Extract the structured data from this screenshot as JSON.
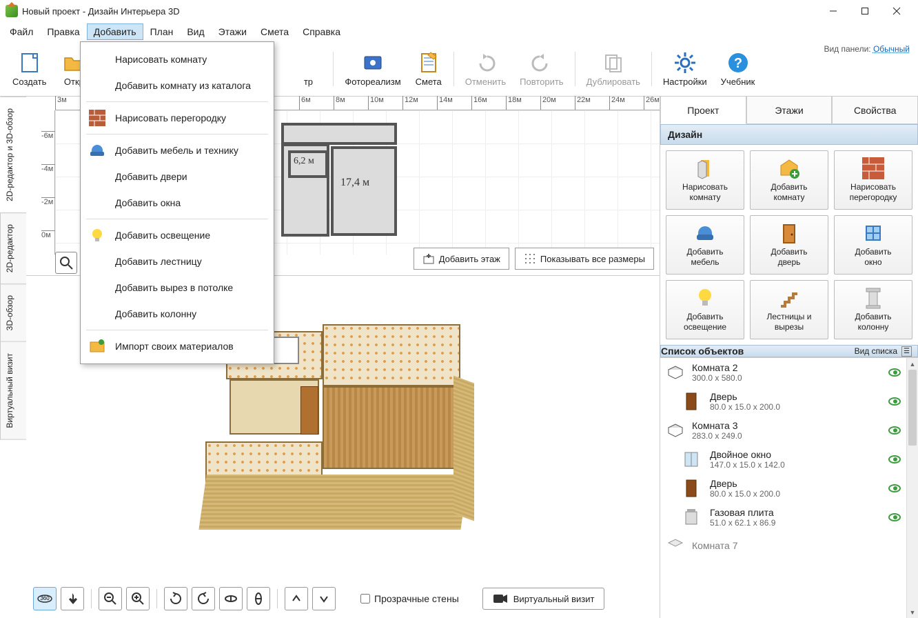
{
  "titlebar": {
    "title": "Новый проект - Дизайн Интерьера 3D"
  },
  "menubar": [
    "Файл",
    "Правка",
    "Добавить",
    "План",
    "Вид",
    "Этажи",
    "Смета",
    "Справка"
  ],
  "active_menu_index": 2,
  "toolbar": {
    "create": "Создать",
    "open": "Откр",
    "hidden1": "тр",
    "photoreal": "Фотореализм",
    "budget": "Смета",
    "undo": "Отменить",
    "redo": "Повторить",
    "duplicate": "Дублировать",
    "settings": "Настройки",
    "help": "Учебник",
    "panel_mode_label": "Вид панели:",
    "panel_mode_value": "Обычный"
  },
  "dropdown": [
    {
      "icon": "draw-room",
      "label": "Нарисовать комнату"
    },
    {
      "icon": "catalog",
      "label": "Добавить комнату из каталога"
    },
    {
      "sep": true
    },
    {
      "icon": "wall",
      "label": "Нарисовать перегородку"
    },
    {
      "sep": true
    },
    {
      "icon": "chair",
      "label": "Добавить мебель и технику"
    },
    {
      "icon": "",
      "label": "Добавить двери"
    },
    {
      "icon": "",
      "label": "Добавить окна"
    },
    {
      "sep": true
    },
    {
      "icon": "bulb",
      "label": "Добавить освещение"
    },
    {
      "icon": "",
      "label": "Добавить лестницу"
    },
    {
      "icon": "",
      "label": "Добавить вырез в потолке"
    },
    {
      "icon": "",
      "label": "Добавить колонну"
    },
    {
      "sep": true
    },
    {
      "icon": "import",
      "label": "Импорт своих материалов"
    }
  ],
  "vtabs": [
    "2D-редактор и 3D-обзор",
    "2D-редактор",
    "3D-обзор",
    "Виртуальный визит"
  ],
  "ruler_h": [
    "3м",
    "6м",
    "8м",
    "10м",
    "12м",
    "14м",
    "16м",
    "18м",
    "20м",
    "22м",
    "24м",
    "26м"
  ],
  "ruler_v": [
    "-6м",
    "-4м",
    "-2м",
    "0м"
  ],
  "plan_areas": {
    "small": "6,2 м",
    "big": "17,4 м"
  },
  "plan_btn_add": "Добавить этаж",
  "plan_btn_dims": "Показывать все размеры",
  "side_tabs": [
    "Проект",
    "Этажи",
    "Свойства"
  ],
  "section_design": "Дизайн",
  "design_buttons": [
    {
      "icon": "tools",
      "l1": "Нарисовать",
      "l2": "комнату"
    },
    {
      "icon": "addbox",
      "l1": "Добавить",
      "l2": "комнату"
    },
    {
      "icon": "brick",
      "l1": "Нарисовать",
      "l2": "перегородку"
    },
    {
      "icon": "sofa",
      "l1": "Добавить",
      "l2": "мебель"
    },
    {
      "icon": "door",
      "l1": "Добавить",
      "l2": "дверь"
    },
    {
      "icon": "window",
      "l1": "Добавить",
      "l2": "окно"
    },
    {
      "icon": "bulb",
      "l1": "Добавить",
      "l2": "освещение"
    },
    {
      "icon": "stairs",
      "l1": "Лестницы и",
      "l2": "вырезы"
    },
    {
      "icon": "column",
      "l1": "Добавить",
      "l2": "колонну"
    }
  ],
  "objlist_title": "Список объектов",
  "objlist_view": "Вид списка",
  "objects": [
    {
      "icon": "room",
      "name": "Комната 2",
      "dim": "300.0 x 580.0",
      "child": false
    },
    {
      "icon": "door",
      "name": "Дверь",
      "dim": "80.0 x 15.0 x 200.0",
      "child": true
    },
    {
      "icon": "room",
      "name": "Комната 3",
      "dim": "283.0 x 249.0",
      "child": false
    },
    {
      "icon": "window",
      "name": "Двойное окно",
      "dim": "147.0 x 15.0 x 142.0",
      "child": true
    },
    {
      "icon": "door",
      "name": "Дверь",
      "dim": "80.0 x 15.0 x 200.0",
      "child": true
    },
    {
      "icon": "stove",
      "name": "Газовая плита",
      "dim": "51.0 x 62.1 x 86.9",
      "child": true
    },
    {
      "icon": "room",
      "name": "Комната 7",
      "dim": "",
      "child": false
    }
  ],
  "bottom": {
    "transparent_walls": "Прозрачные стены",
    "virtual_visit": "Виртуальный визит"
  }
}
